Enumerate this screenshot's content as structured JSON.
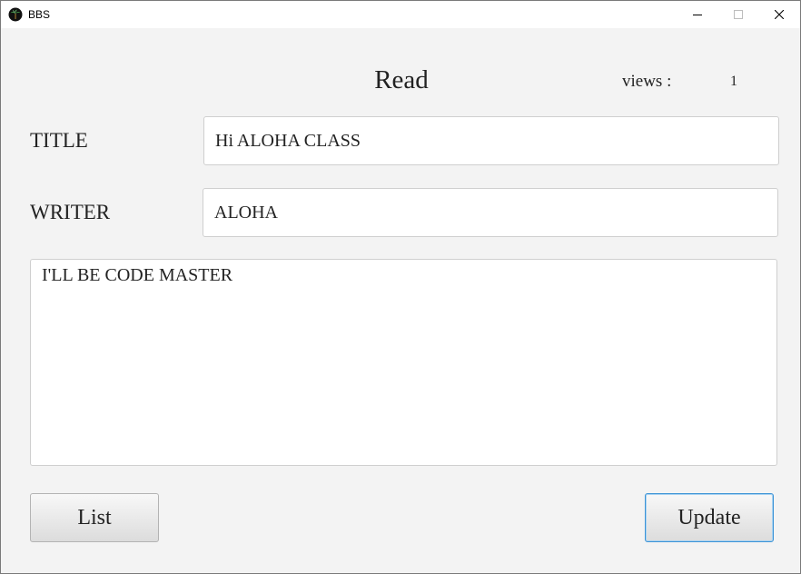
{
  "window": {
    "title": "BBS",
    "icon": "palm-tree-icon"
  },
  "page": {
    "heading": "Read",
    "views_label": "views :",
    "views_value": "1"
  },
  "form": {
    "title_label": "TITLE",
    "title_value": "Hi ALOHA CLASS",
    "writer_label": "WRITER",
    "writer_value": "ALOHA",
    "content_value": "I'LL BE CODE MASTER"
  },
  "buttons": {
    "list_label": "List",
    "update_label": "Update"
  },
  "colors": {
    "window_background": "#f3f3f3",
    "focus_border": "#3c93d6"
  }
}
